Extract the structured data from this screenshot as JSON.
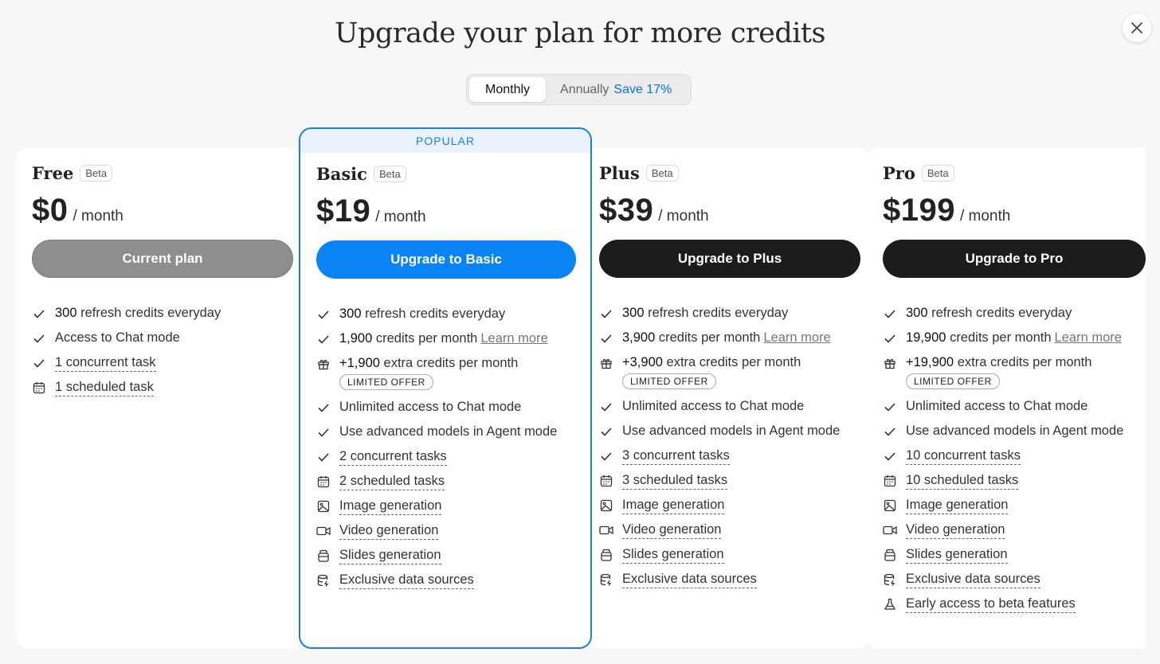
{
  "header": {
    "title": "Upgrade your plan for more credits"
  },
  "close": {
    "icon": "close-icon"
  },
  "billing_toggle": {
    "monthly": "Monthly",
    "annually": "Annually",
    "save": "Save 17%",
    "selected": "Monthly"
  },
  "colors": {
    "accent": "#0a84f5",
    "popular_bg": "#eaf3fd",
    "dark_button": "#1c1c1c",
    "current_button": "#8e8e8e"
  },
  "plans": {
    "free": {
      "name": "Free",
      "badge": "Beta",
      "price": "$0",
      "period": "/ month",
      "cta": "Current plan",
      "f1_num": "300",
      "f1_text": "refresh credits everyday",
      "f2_text": "Access to Chat mode",
      "f3_text": "1 concurrent task",
      "f4_text": "1 scheduled task"
    },
    "basic": {
      "popular": "POPULAR",
      "name": "Basic",
      "badge": "Beta",
      "price": "$19",
      "period": "/ month",
      "cta": "Upgrade to Basic",
      "f1_num": "300",
      "f1_text": "refresh credits everyday",
      "f2_num": "1,900",
      "f2_text": "credits per month",
      "f2_link": "Learn more",
      "f3_num": "+1,900",
      "f3_text": "extra credits per month",
      "f3_badge": "LIMITED OFFER",
      "f4_text": "Unlimited access to Chat mode",
      "f5_text": "Use advanced models in Agent mode",
      "f6_text": "2 concurrent tasks",
      "f7_text": "2 scheduled tasks",
      "f8_text": "Image generation",
      "f9_text": "Video generation",
      "f10_text": "Slides generation",
      "f11_text": "Exclusive data sources"
    },
    "plus": {
      "name": "Plus",
      "badge": "Beta",
      "price": "$39",
      "period": "/ month",
      "cta": "Upgrade to Plus",
      "f1_num": "300",
      "f1_text": "refresh credits everyday",
      "f2_num": "3,900",
      "f2_text": "credits per month",
      "f2_link": "Learn more",
      "f3_num": "+3,900",
      "f3_text": "extra credits per month",
      "f3_badge": "LIMITED OFFER",
      "f4_text": "Unlimited access to Chat mode",
      "f5_text": "Use advanced models in Agent mode",
      "f6_text": "3 concurrent tasks",
      "f7_text": "3 scheduled tasks",
      "f8_text": "Image generation",
      "f9_text": "Video generation",
      "f10_text": "Slides generation",
      "f11_text": "Exclusive data sources"
    },
    "pro": {
      "name": "Pro",
      "badge": "Beta",
      "price": "$199",
      "period": "/ month",
      "cta": "Upgrade to Pro",
      "f1_num": "300",
      "f1_text": "refresh credits everyday",
      "f2_num": "19,900",
      "f2_text": "credits per month",
      "f2_link": "Learn more",
      "f3_num": "+19,900",
      "f3_text": "extra credits per month",
      "f3_badge": "LIMITED OFFER",
      "f4_text": "Unlimited access to Chat mode",
      "f5_text": "Use advanced models in Agent mode",
      "f6_text": "10 concurrent tasks",
      "f7_text": "10 scheduled tasks",
      "f8_text": "Image generation",
      "f9_text": "Video generation",
      "f10_text": "Slides generation",
      "f11_text": "Exclusive data sources",
      "f12_text": "Early access to beta features"
    }
  }
}
